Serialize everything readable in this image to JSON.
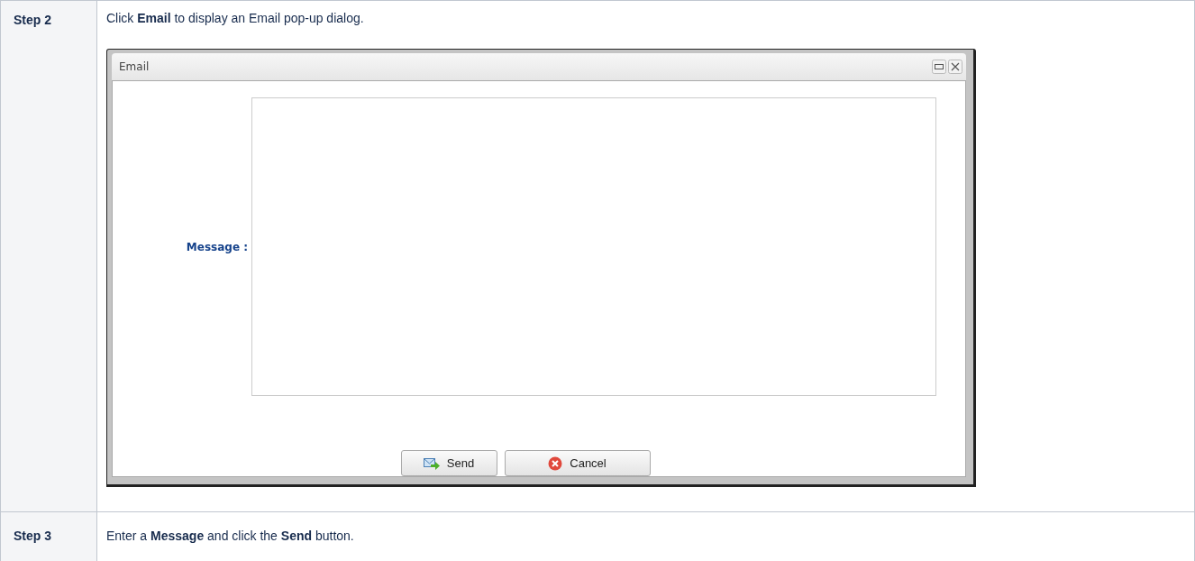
{
  "steps": [
    {
      "label": "Step 2",
      "text": "Click **Email** to display an Email pop-up dialog.",
      "dialog": {
        "title": "Email",
        "field_label": "Message :",
        "buttons": [
          {
            "kind": "send",
            "label": "Send"
          },
          {
            "kind": "cancel",
            "label": "Cancel"
          }
        ]
      }
    },
    {
      "label": "Step 3",
      "text": "Enter a **Message** and click the **Send** button."
    }
  ]
}
